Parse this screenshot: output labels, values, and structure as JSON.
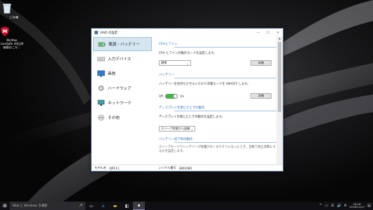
{
  "desktop": {
    "icons": [
      {
        "name": "recycle-bin",
        "label": "ごみ箱"
      },
      {
        "name": "mcafee-livesafe",
        "label": "McAfee LiveSafe 30日評価版はこち..."
      }
    ]
  },
  "window": {
    "title": "VAIO の設定",
    "minimize": "—",
    "maximize": "☐",
    "close": "✕",
    "nav": [
      {
        "label": "電源・バッテリー",
        "icon": "power-battery-icon",
        "active": true
      },
      {
        "label": "入力デバイス",
        "icon": "keyboard-icon"
      },
      {
        "label": "画質",
        "icon": "display-quality-icon"
      },
      {
        "label": "ハードウェア",
        "icon": "hardware-gear-icon"
      },
      {
        "label": "ネットワーク",
        "icon": "network-icon"
      },
      {
        "label": "その他",
        "icon": "other-icon"
      }
    ],
    "sections": {
      "cpu": {
        "title": "CPUとファン",
        "desc": "CPU とファンの動作モードを設定します。",
        "select_value": "標準",
        "detail_button": "詳細"
      },
      "battery": {
        "title": "バッテリー",
        "desc": "バッテリーを長持ちさせるいたわり充電モードを ON/OFF します。",
        "toggle_off": "Off",
        "toggle_on": "On",
        "detail_button": "詳細"
      },
      "display_close": {
        "title": "ディスプレイを閉じたときの動作",
        "desc": "ディスプレイを閉じたときの動作を設定します。",
        "select_value": "スリープ状態から起動"
      },
      "battery_low": {
        "title": "バッテリー低下時の動作",
        "desc": "スリープモードでバッテリーが残量がなくなりそうになったとき、自動で休止状態にするかを設定します。"
      }
    },
    "status": {
      "model_label": "モデル名",
      "model_value": "VJP111",
      "serial_label": "シリアル番号",
      "serial_value": "3801080"
    }
  },
  "taskbar": {
    "start": "⊞",
    "search_placeholder": "Web と Windows を検索",
    "mic": "🎤",
    "apps": [
      "task-view-icon",
      "edge-icon",
      "file-explorer-icon",
      "store-icon",
      "vaio-settings-icon"
    ],
    "tray": {
      "chevron": "^",
      "battery": "▭",
      "network": "☰",
      "volume": "🔊",
      "ime": "A",
      "time": "16:26",
      "date": "2016/11/07"
    }
  }
}
